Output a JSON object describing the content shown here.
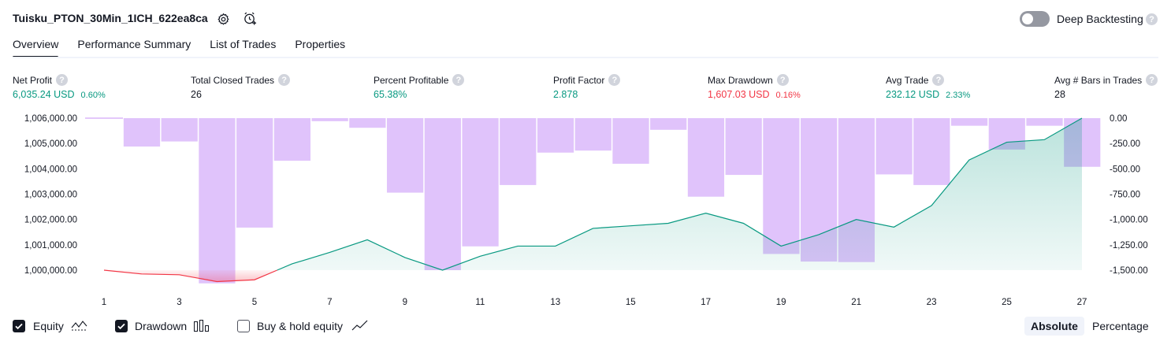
{
  "header": {
    "strategy_name": "Tuisku_PTON_30Min_1ICH_622ea8ca",
    "settings_icon": "gear-icon",
    "alert_icon": "alarm-add-icon",
    "deep_backtesting_label": "Deep Backtesting",
    "deep_backtesting_enabled": false,
    "help_glyph": "?"
  },
  "tabs": [
    {
      "label": "Overview",
      "active": true
    },
    {
      "label": "Performance Summary",
      "active": false
    },
    {
      "label": "List of Trades",
      "active": false
    },
    {
      "label": "Properties",
      "active": false
    }
  ],
  "stats": [
    {
      "label": "Net Profit",
      "value": "6,035.24 USD",
      "pct": "0.60%",
      "color": "#089981"
    },
    {
      "label": "Total Closed Trades",
      "value": "26",
      "pct": "",
      "color": "#131722"
    },
    {
      "label": "Percent Profitable",
      "value": "65.38%",
      "pct": "",
      "color": "#089981"
    },
    {
      "label": "Profit Factor",
      "value": "2.878",
      "pct": "",
      "color": "#089981"
    },
    {
      "label": "Max Drawdown",
      "value": "1,607.03 USD",
      "pct": "0.16%",
      "color": "#f23645"
    },
    {
      "label": "Avg Trade",
      "value": "232.12 USD",
      "pct": "2.33%",
      "color": "#089981"
    },
    {
      "label": "Avg # Bars in Trades",
      "value": "28",
      "pct": "",
      "color": "#131722"
    }
  ],
  "chart_data": {
    "type": "line",
    "x_ticks": [
      "1",
      "3",
      "5",
      "7",
      "9",
      "11",
      "13",
      "15",
      "17",
      "19",
      "21",
      "23",
      "25",
      "27"
    ],
    "left_axis": {
      "ticks": [
        "1,006,000.00",
        "1,005,000.00",
        "1,004,000.00",
        "1,003,000.00",
        "1,002,000.00",
        "1,001,000.00",
        "1,000,000.00"
      ],
      "ylim": [
        1000000,
        1006000
      ]
    },
    "right_axis": {
      "ticks": [
        "0.00",
        "-250.00",
        "-500.00",
        "-750.00",
        "-1,000.00",
        "-1,250.00",
        "-1,500.00"
      ],
      "ylim": [
        -1500,
        0
      ]
    },
    "series": [
      {
        "name": "Equity",
        "color": "#089981",
        "below_start_color": "#f23645",
        "x": [
          1,
          2,
          3,
          4,
          5,
          6,
          7,
          8,
          9,
          10,
          11,
          12,
          13,
          14,
          15,
          16,
          17,
          18,
          19,
          20,
          21,
          22,
          23,
          24,
          25,
          26,
          27
        ],
        "values": [
          1000000,
          999850,
          999820,
          999550,
          999620,
          1000250,
          1000700,
          1001200,
          1000500,
          1000000,
          1000550,
          1000950,
          1000950,
          1001650,
          1001750,
          1001850,
          1002250,
          1001850,
          1000950,
          1001400,
          1002000,
          1001700,
          1002550,
          1004350,
          1005050,
          1005150,
          1006000
        ]
      },
      {
        "name": "Drawdown",
        "color": "#c792f7",
        "x": [
          1,
          2,
          3,
          4,
          5,
          6,
          7,
          8,
          9,
          10,
          11,
          12,
          13,
          14,
          15,
          16,
          17,
          18,
          19,
          20,
          21,
          22,
          23,
          24,
          25,
          26,
          27
        ],
        "values": [
          0,
          -280,
          -230,
          -1630,
          -1080,
          -420,
          -30,
          -95,
          -735,
          -1500,
          -1265,
          -660,
          -340,
          -320,
          -450,
          -115,
          -775,
          -560,
          -1340,
          -1415,
          -1420,
          -555,
          -660,
          -75,
          -310,
          -75,
          -480
        ]
      }
    ]
  },
  "legend": [
    {
      "label": "Equity",
      "checked": true,
      "icon": "equity-line-icon"
    },
    {
      "label": "Drawdown",
      "checked": true,
      "icon": "drawdown-bars-icon"
    },
    {
      "label": "Buy & hold equity",
      "checked": false,
      "icon": "buy-hold-line-icon"
    }
  ],
  "view_mode": {
    "options": [
      "Absolute",
      "Percentage"
    ],
    "selected": "Absolute"
  }
}
